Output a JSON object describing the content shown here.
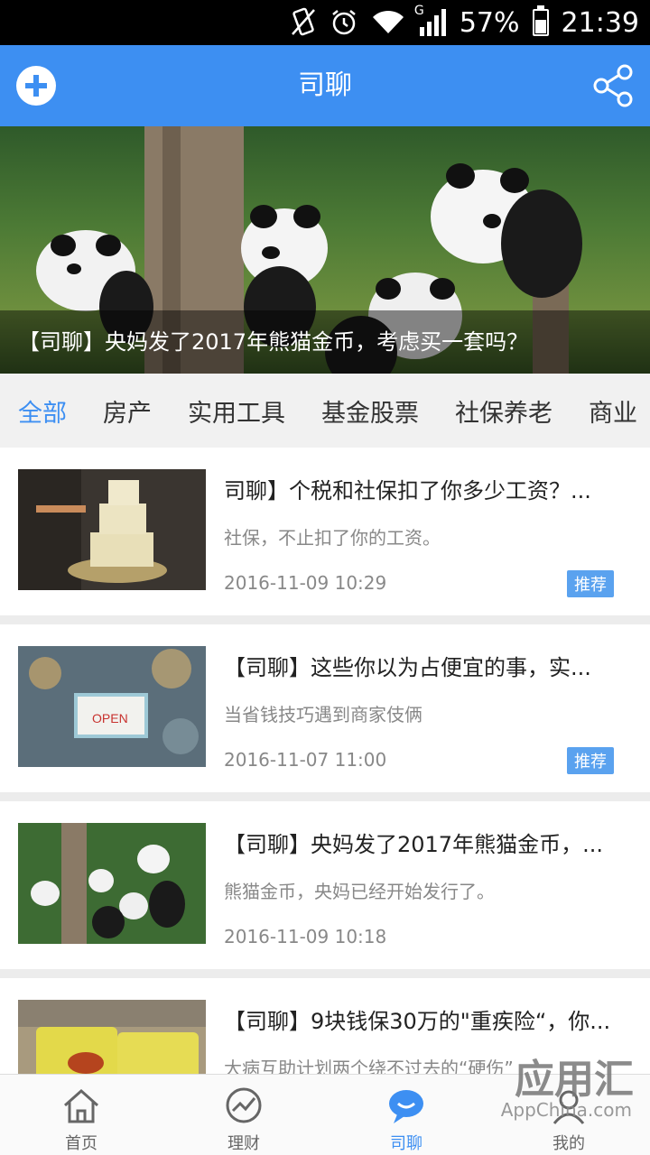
{
  "status_bar": {
    "battery": "57%",
    "time": "21:39",
    "network": "G"
  },
  "header": {
    "title": "司聊"
  },
  "banner": {
    "caption": "【司聊】央妈发了2017年熊猫金币，考虑买一套吗？"
  },
  "categories": [
    "全部",
    "房产",
    "实用工具",
    "基金股票",
    "社保养老",
    "商业"
  ],
  "articles": [
    {
      "title": "司聊】个税和社保扣了你多少工资？...",
      "summary": "社保，不止扣了你的工资。",
      "date": "2016-11-09 10:29",
      "tag": "推荐"
    },
    {
      "title": "【司聊】这些你以为占便宜的事，实...",
      "summary": "当省钱技巧遇到商家伎俩",
      "date": "2016-11-07 11:00",
      "tag": "推荐"
    },
    {
      "title": "【司聊】央妈发了2017年熊猫金币，...",
      "summary": "熊猫金币，央妈已经开始发行了。",
      "date": "2016-11-09 10:18",
      "tag": ""
    },
    {
      "title": "【司聊】9块钱保30万的\"重疾险“，你...",
      "summary": "大病互助计划两个绕不过去的“硬伤”",
      "date": "",
      "tag": ""
    }
  ],
  "thumb_text": {
    "open_sign": "OPEN"
  },
  "bottom_nav": [
    {
      "label": "首页",
      "icon": "home-icon"
    },
    {
      "label": "理财",
      "icon": "chart-trend-icon"
    },
    {
      "label": "司聊",
      "icon": "chat-icon"
    },
    {
      "label": "我的",
      "icon": "profile-icon"
    }
  ],
  "watermark": {
    "text": "应用汇",
    "sub": "AppChina.com"
  },
  "colors": {
    "accent": "#3d8ff2",
    "tag": "#5aa2ef"
  }
}
